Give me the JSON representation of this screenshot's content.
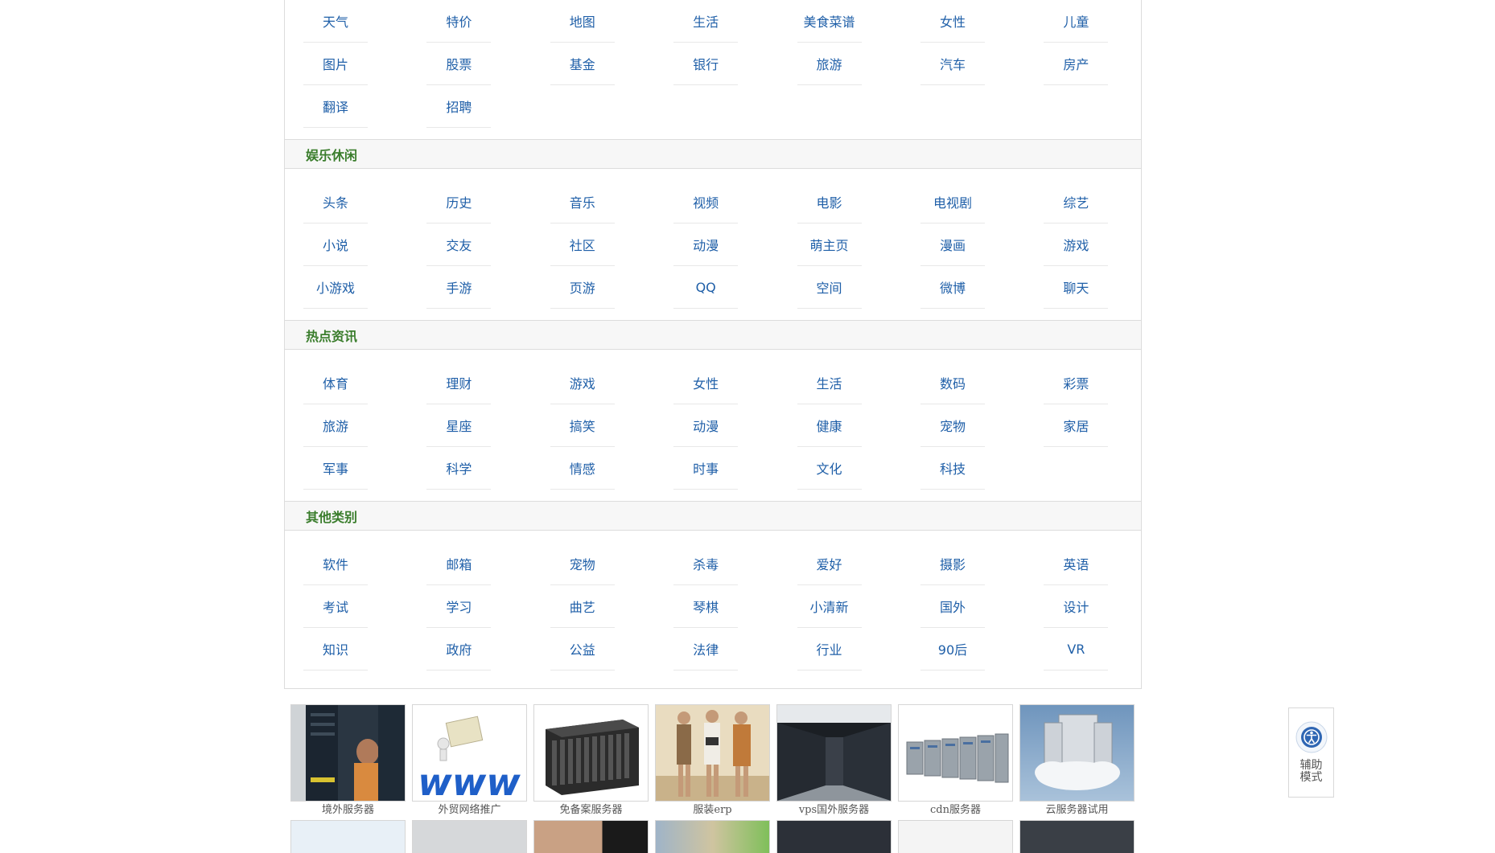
{
  "sections": {
    "top": {
      "items": [
        "天气",
        "特价",
        "地图",
        "生活",
        "美食菜谱",
        "女性",
        "儿童",
        "图片",
        "股票",
        "基金",
        "银行",
        "旅游",
        "汽车",
        "房产",
        "翻译",
        "招聘"
      ]
    },
    "entertainment": {
      "title": "娱乐休闲",
      "items": [
        "头条",
        "历史",
        "音乐",
        "视频",
        "电影",
        "电视剧",
        "综艺",
        "小说",
        "交友",
        "社区",
        "动漫",
        "萌主页",
        "漫画",
        "游戏",
        "小游戏",
        "手游",
        "页游",
        "QQ",
        "空间",
        "微博",
        "聊天"
      ]
    },
    "news": {
      "title": "热点资讯",
      "items": [
        "体育",
        "理财",
        "游戏",
        "女性",
        "生活",
        "数码",
        "彩票",
        "旅游",
        "星座",
        "搞笑",
        "动漫",
        "健康",
        "宠物",
        "家居",
        "军事",
        "科学",
        "情感",
        "时事",
        "文化",
        "科技"
      ]
    },
    "other": {
      "title": "其他类别",
      "items": [
        "软件",
        "邮箱",
        "宠物",
        "杀毒",
        "爱好",
        "摄影",
        "英语",
        "考试",
        "学习",
        "曲艺",
        "琴棋",
        "小清新",
        "国外",
        "设计",
        "知识",
        "政府",
        "公益",
        "法律",
        "行业",
        "90后",
        "VR"
      ]
    }
  },
  "thumbs": [
    "境外服务器",
    "外贸网络推广",
    "免备案服务器",
    "服装erp",
    "vps国外服务器",
    "cdn服务器",
    "云服务器试用"
  ],
  "side_widget": {
    "label": "辅助模式",
    "icon": "accessibility-icon"
  },
  "colors": {
    "link": "#1f5fa8",
    "section_title": "#3a7d2c",
    "header_bg": "#f7f7f7",
    "border": "#dcdcdc"
  }
}
